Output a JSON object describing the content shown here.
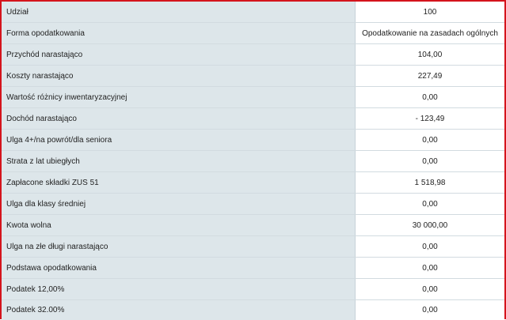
{
  "rows": [
    {
      "label": "Udział",
      "value": "100"
    },
    {
      "label": "Forma opodatkowania",
      "value": "Opodatkowanie na zasadach ogólnych"
    },
    {
      "label": "Przychód narastająco",
      "value": "104,00"
    },
    {
      "label": "Koszty narastająco",
      "value": "227,49"
    },
    {
      "label": "Wartość różnicy inwentaryzacyjnej",
      "value": "0,00"
    },
    {
      "label": "Dochód narastająco",
      "value": "- 123,49"
    },
    {
      "label": "Ulga 4+/na powrót/dla seniora",
      "value": "0,00"
    },
    {
      "label": "Strata z lat ubiegłych",
      "value": "0,00"
    },
    {
      "label": "Zapłacone składki ZUS 51",
      "value": "1 518,98"
    },
    {
      "label": "Ulga dla klasy średniej",
      "value": "0,00"
    },
    {
      "label": "Kwota wolna",
      "value": "30 000,00"
    },
    {
      "label": "Ulga na złe długi narastająco",
      "value": "0,00"
    },
    {
      "label": "Podstawa opodatkowania",
      "value": "0,00"
    },
    {
      "label": "Podatek 12,00%",
      "value": "0,00"
    },
    {
      "label": "Podatek 32.00%",
      "value": "0,00"
    }
  ],
  "colors": {
    "frame_border": "#d4141c",
    "label_background": "#dde6ea",
    "value_background": "#ffffff",
    "row_divider": "#d2dbe0"
  }
}
